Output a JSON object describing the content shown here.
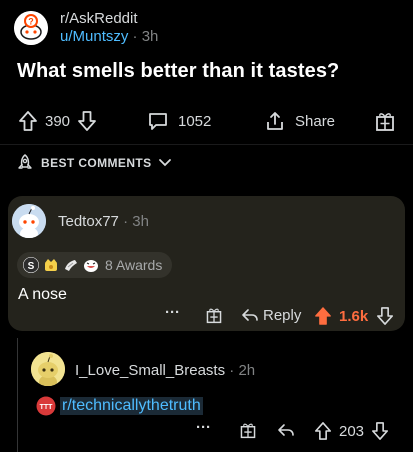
{
  "post": {
    "subreddit": "r/AskReddit",
    "author": "u/Muntszy",
    "separator": "·",
    "age": "3h",
    "title": "What smells better than it tastes?",
    "votes": "390",
    "comments": "1052",
    "share_label": "Share"
  },
  "sort": {
    "label": "BEST COMMENTS"
  },
  "comment": {
    "author": "Tedtox77",
    "separator": "·",
    "age": "3h",
    "awards_label": "8 Awards",
    "body": "A nose",
    "more": "···",
    "reply_label": "Reply",
    "votes": "1.6k",
    "vote_color": "#ff6d3f"
  },
  "reply": {
    "author": "I_Love_Small_Breasts",
    "separator": "·",
    "age": "2h",
    "link_text": "r/technicallythetruth",
    "more": "···",
    "votes": "203"
  },
  "colors": {
    "link": "#4fbcff",
    "card": "#24231c",
    "upvoted": "#ff6d3f"
  }
}
